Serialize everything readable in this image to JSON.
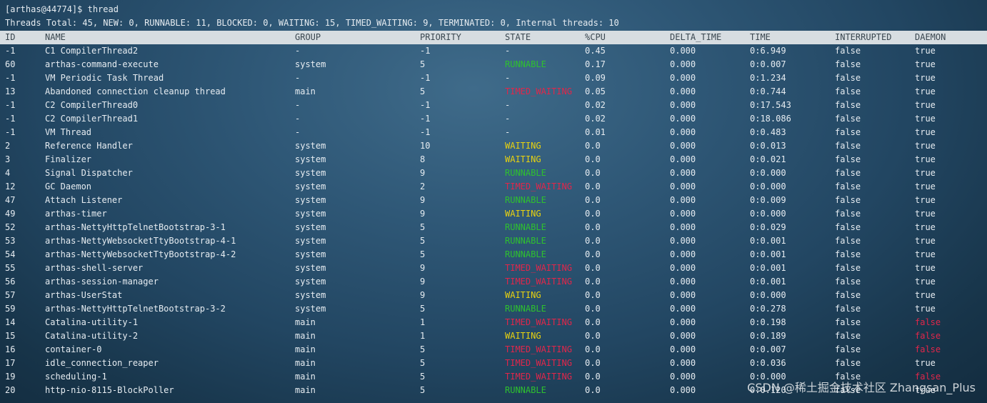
{
  "terminal": {
    "prompt": "[arthas@44774]$ thread",
    "summary": "Threads Total: 45, NEW: 0, RUNNABLE: 11, BLOCKED: 0, WAITING: 15, TIMED_WAITING: 9, TERMINATED: 0, Internal threads: 10"
  },
  "columns": [
    "ID",
    "NAME",
    "GROUP",
    "PRIORITY",
    "STATE",
    "%CPU",
    "DELTA_TIME",
    "TIME",
    "INTERRUPTED",
    "DAEMON"
  ],
  "rows": [
    {
      "id": "-1",
      "name": "C1 CompilerThread2",
      "group": "-",
      "priority": "-1",
      "state": "-",
      "cpu": "0.45",
      "delta": "0.000",
      "time": "0:6.949",
      "interrupted": "false",
      "daemon": "true"
    },
    {
      "id": "60",
      "name": "arthas-command-execute",
      "group": "system",
      "priority": "5",
      "state": "RUNNABLE",
      "cpu": "0.17",
      "delta": "0.000",
      "time": "0:0.007",
      "interrupted": "false",
      "daemon": "true"
    },
    {
      "id": "-1",
      "name": "VM Periodic Task Thread",
      "group": "-",
      "priority": "-1",
      "state": "-",
      "cpu": "0.09",
      "delta": "0.000",
      "time": "0:1.234",
      "interrupted": "false",
      "daemon": "true"
    },
    {
      "id": "13",
      "name": "Abandoned connection cleanup thread",
      "group": "main",
      "priority": "5",
      "state": "TIMED_WAITING",
      "cpu": "0.05",
      "delta": "0.000",
      "time": "0:0.744",
      "interrupted": "false",
      "daemon": "true"
    },
    {
      "id": "-1",
      "name": "C2 CompilerThread0",
      "group": "-",
      "priority": "-1",
      "state": "-",
      "cpu": "0.02",
      "delta": "0.000",
      "time": "0:17.543",
      "interrupted": "false",
      "daemon": "true"
    },
    {
      "id": "-1",
      "name": "C2 CompilerThread1",
      "group": "-",
      "priority": "-1",
      "state": "-",
      "cpu": "0.02",
      "delta": "0.000",
      "time": "0:18.086",
      "interrupted": "false",
      "daemon": "true"
    },
    {
      "id": "-1",
      "name": "VM Thread",
      "group": "-",
      "priority": "-1",
      "state": "-",
      "cpu": "0.01",
      "delta": "0.000",
      "time": "0:0.483",
      "interrupted": "false",
      "daemon": "true"
    },
    {
      "id": "2",
      "name": "Reference Handler",
      "group": "system",
      "priority": "10",
      "state": "WAITING",
      "cpu": "0.0",
      "delta": "0.000",
      "time": "0:0.013",
      "interrupted": "false",
      "daemon": "true"
    },
    {
      "id": "3",
      "name": "Finalizer",
      "group": "system",
      "priority": "8",
      "state": "WAITING",
      "cpu": "0.0",
      "delta": "0.000",
      "time": "0:0.021",
      "interrupted": "false",
      "daemon": "true"
    },
    {
      "id": "4",
      "name": "Signal Dispatcher",
      "group": "system",
      "priority": "9",
      "state": "RUNNABLE",
      "cpu": "0.0",
      "delta": "0.000",
      "time": "0:0.000",
      "interrupted": "false",
      "daemon": "true"
    },
    {
      "id": "12",
      "name": "GC Daemon",
      "group": "system",
      "priority": "2",
      "state": "TIMED_WAITING",
      "cpu": "0.0",
      "delta": "0.000",
      "time": "0:0.000",
      "interrupted": "false",
      "daemon": "true"
    },
    {
      "id": "47",
      "name": "Attach Listener",
      "group": "system",
      "priority": "9",
      "state": "RUNNABLE",
      "cpu": "0.0",
      "delta": "0.000",
      "time": "0:0.009",
      "interrupted": "false",
      "daemon": "true"
    },
    {
      "id": "49",
      "name": "arthas-timer",
      "group": "system",
      "priority": "9",
      "state": "WAITING",
      "cpu": "0.0",
      "delta": "0.000",
      "time": "0:0.000",
      "interrupted": "false",
      "daemon": "true"
    },
    {
      "id": "52",
      "name": "arthas-NettyHttpTelnetBootstrap-3-1",
      "group": "system",
      "priority": "5",
      "state": "RUNNABLE",
      "cpu": "0.0",
      "delta": "0.000",
      "time": "0:0.029",
      "interrupted": "false",
      "daemon": "true"
    },
    {
      "id": "53",
      "name": "arthas-NettyWebsocketTtyBootstrap-4-1",
      "group": "system",
      "priority": "5",
      "state": "RUNNABLE",
      "cpu": "0.0",
      "delta": "0.000",
      "time": "0:0.001",
      "interrupted": "false",
      "daemon": "true"
    },
    {
      "id": "54",
      "name": "arthas-NettyWebsocketTtyBootstrap-4-2",
      "group": "system",
      "priority": "5",
      "state": "RUNNABLE",
      "cpu": "0.0",
      "delta": "0.000",
      "time": "0:0.001",
      "interrupted": "false",
      "daemon": "true"
    },
    {
      "id": "55",
      "name": "arthas-shell-server",
      "group": "system",
      "priority": "9",
      "state": "TIMED_WAITING",
      "cpu": "0.0",
      "delta": "0.000",
      "time": "0:0.001",
      "interrupted": "false",
      "daemon": "true"
    },
    {
      "id": "56",
      "name": "arthas-session-manager",
      "group": "system",
      "priority": "9",
      "state": "TIMED_WAITING",
      "cpu": "0.0",
      "delta": "0.000",
      "time": "0:0.001",
      "interrupted": "false",
      "daemon": "true"
    },
    {
      "id": "57",
      "name": "arthas-UserStat",
      "group": "system",
      "priority": "9",
      "state": "WAITING",
      "cpu": "0.0",
      "delta": "0.000",
      "time": "0:0.000",
      "interrupted": "false",
      "daemon": "true"
    },
    {
      "id": "59",
      "name": "arthas-NettyHttpTelnetBootstrap-3-2",
      "group": "system",
      "priority": "5",
      "state": "RUNNABLE",
      "cpu": "0.0",
      "delta": "0.000",
      "time": "0:0.278",
      "interrupted": "false",
      "daemon": "true"
    },
    {
      "id": "14",
      "name": "Catalina-utility-1",
      "group": "main",
      "priority": "1",
      "state": "TIMED_WAITING",
      "cpu": "0.0",
      "delta": "0.000",
      "time": "0:0.198",
      "interrupted": "false",
      "daemon": "false"
    },
    {
      "id": "15",
      "name": "Catalina-utility-2",
      "group": "main",
      "priority": "1",
      "state": "WAITING",
      "cpu": "0.0",
      "delta": "0.000",
      "time": "0:0.189",
      "interrupted": "false",
      "daemon": "false"
    },
    {
      "id": "16",
      "name": "container-0",
      "group": "main",
      "priority": "5",
      "state": "TIMED_WAITING",
      "cpu": "0.0",
      "delta": "0.000",
      "time": "0:0.007",
      "interrupted": "false",
      "daemon": "false"
    },
    {
      "id": "17",
      "name": "idle_connection_reaper",
      "group": "main",
      "priority": "5",
      "state": "TIMED_WAITING",
      "cpu": "0.0",
      "delta": "0.000",
      "time": "0:0.036",
      "interrupted": "false",
      "daemon": "true"
    },
    {
      "id": "19",
      "name": "scheduling-1",
      "group": "main",
      "priority": "5",
      "state": "TIMED_WAITING",
      "cpu": "0.0",
      "delta": "0.000",
      "time": "0:0.000",
      "interrupted": "false",
      "daemon": "false"
    },
    {
      "id": "20",
      "name": "http-nio-8115-BlockPoller",
      "group": "main",
      "priority": "5",
      "state": "RUNNABLE",
      "cpu": "0.0",
      "delta": "0.000",
      "time": "0:0.120",
      "interrupted": "false",
      "daemon": "true"
    }
  ],
  "state_colors": {
    "RUNNABLE": "#2ec12e",
    "WAITING": "#e8d210",
    "TIMED_WAITING": "#e1264a"
  },
  "watermark": "CSDN @稀土掘金技术社区 Zhangsan_Plus"
}
